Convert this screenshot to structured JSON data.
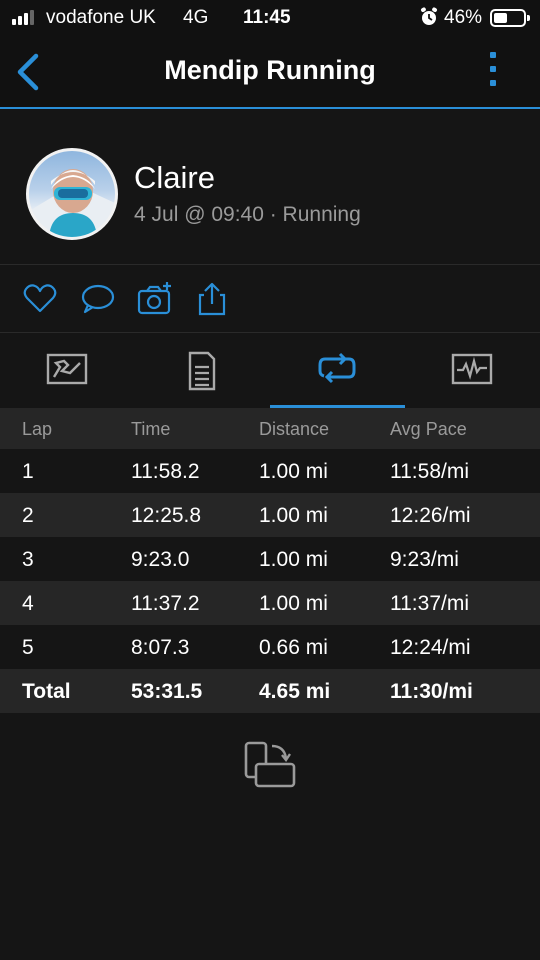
{
  "status_bar": {
    "carrier": "vodafone UK",
    "network": "4G",
    "time": "11:45",
    "battery": "46%",
    "battery_level": 0.46,
    "icons": [
      "signal-icon",
      "alarm-icon",
      "battery-icon"
    ]
  },
  "nav": {
    "title": "Mendip Running",
    "back_icon": "chevron-left-icon",
    "more_icon": "more-vertical-icon",
    "accent": "#2a8fd8"
  },
  "profile": {
    "name": "Claire",
    "meta": "4 Jul @ 09:40 · Running"
  },
  "actions": [
    {
      "icon": "heart-icon"
    },
    {
      "icon": "comment-icon"
    },
    {
      "icon": "add-photo-icon"
    },
    {
      "icon": "share-icon"
    }
  ],
  "tabs": [
    {
      "icon": "map-icon",
      "active": false
    },
    {
      "icon": "details-icon",
      "active": false
    },
    {
      "icon": "laps-icon",
      "active": true
    },
    {
      "icon": "stats-chart-icon",
      "active": false
    }
  ],
  "table": {
    "headers": [
      "Lap",
      "Time",
      "Distance",
      "Avg Pace"
    ],
    "rows": [
      [
        "1",
        "11:58.2",
        "1.00 mi",
        "11:58/mi"
      ],
      [
        "2",
        "12:25.8",
        "1.00 mi",
        "12:26/mi"
      ],
      [
        "3",
        "9:23.0",
        "1.00 mi",
        "9:23/mi"
      ],
      [
        "4",
        "11:37.2",
        "1.00 mi",
        "11:37/mi"
      ],
      [
        "5",
        "8:07.3",
        "0.66 mi",
        "12:24/mi"
      ]
    ],
    "total": [
      "Total",
      "53:31.5",
      "4.65 mi",
      "11:30/mi"
    ]
  },
  "footer": {
    "icon": "rotate-screen-icon"
  }
}
